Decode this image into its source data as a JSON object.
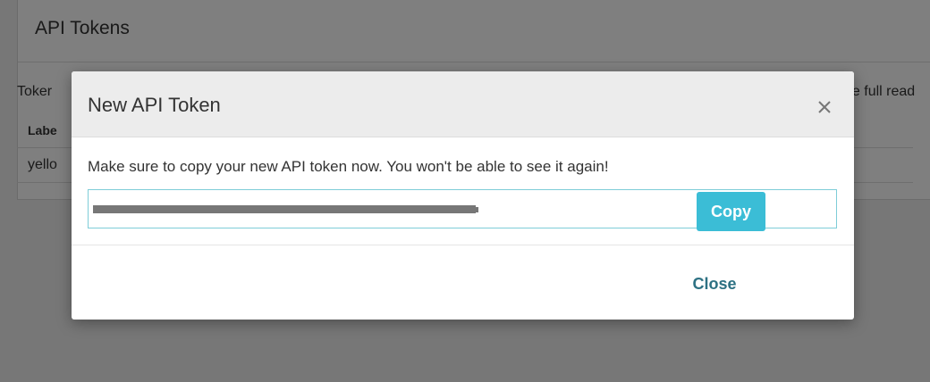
{
  "background": {
    "title": "API Tokens",
    "description_left": "Toker",
    "description_right": "ave full read",
    "table": {
      "header": "Labe",
      "row_label": "yello"
    }
  },
  "modal": {
    "title": "New API Token",
    "close_icon": "close-icon",
    "message": "Make sure to copy your new API token now. You won't be able to see it again!",
    "token_value": "",
    "buttons": {
      "close_label": "Close",
      "copy_label": "Copy"
    }
  },
  "colors": {
    "accent": "#3bbdd6",
    "link": "#2d7183",
    "field_border": "#7ecdd8"
  }
}
